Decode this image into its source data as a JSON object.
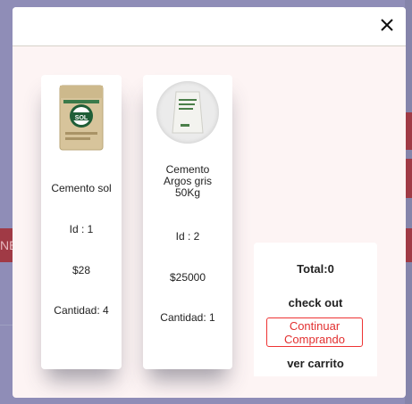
{
  "background": {
    "fragment_left_label": "NE"
  },
  "modal": {
    "close_icon": "close-icon"
  },
  "products": [
    {
      "name": "Cemento sol",
      "id_label": "Id : 1",
      "price": "$28",
      "quantity_label": "Cantidad: 4",
      "image_icon": "cement-bag-sol-image",
      "image_text": "SOL"
    },
    {
      "name": "Cemento Argos gris 50Kg",
      "id_label": "Id : 2",
      "price": "$25000",
      "quantity_label": "Cantidad: 1",
      "image_icon": "cement-bag-argos-image"
    }
  ],
  "summary": {
    "total": "Total:0",
    "checkout": "check out",
    "continue": "Continuar Comprando",
    "view_cart": "ver carrito"
  },
  "colors": {
    "overlay": "#8f8db7",
    "modal_body": "#fdf4f4",
    "accent_red": "#e23030",
    "background_button": "#a03a45"
  }
}
